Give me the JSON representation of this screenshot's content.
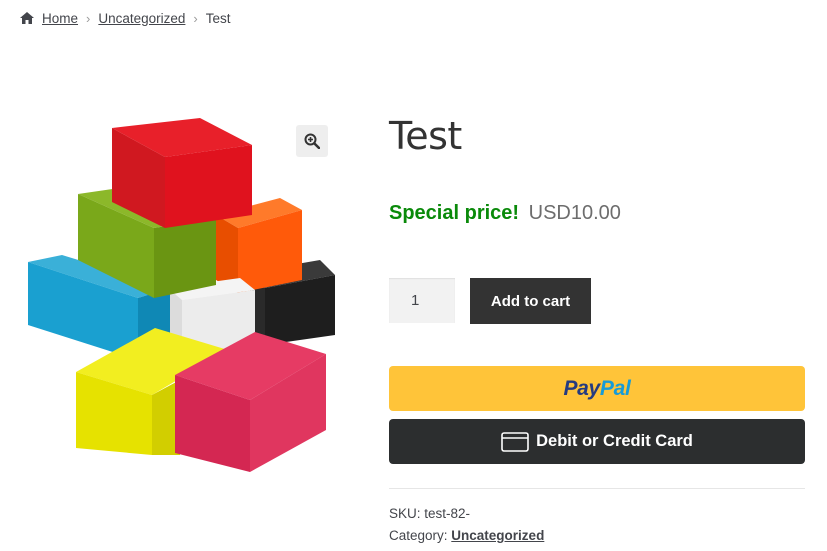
{
  "breadcrumb": {
    "home": "Home",
    "category": "Uncategorized",
    "current": "Test",
    "separator": "›"
  },
  "product": {
    "title": "Test",
    "price_label": "Special price!",
    "price": "USD10.00",
    "quantity": "1",
    "add_to_cart": "Add to cart",
    "image_name": "stacked-colored-boxes"
  },
  "payment": {
    "paypal_pay": "Pay",
    "paypal_pal": "Pal",
    "card_label": "Debit or Credit Card"
  },
  "meta": {
    "sku_label": "SKU:",
    "sku_value": "test-82-",
    "category_label": "Category:",
    "category_value": "Uncategorized"
  },
  "colors": {
    "special_price": "#0a8a0a",
    "paypal_bg": "#ffc439",
    "card_bg": "#2c2e2f",
    "add_to_cart_bg": "#333333"
  },
  "icons": {
    "home": "home-icon",
    "zoom": "zoom-icon",
    "card": "credit-card-icon"
  }
}
